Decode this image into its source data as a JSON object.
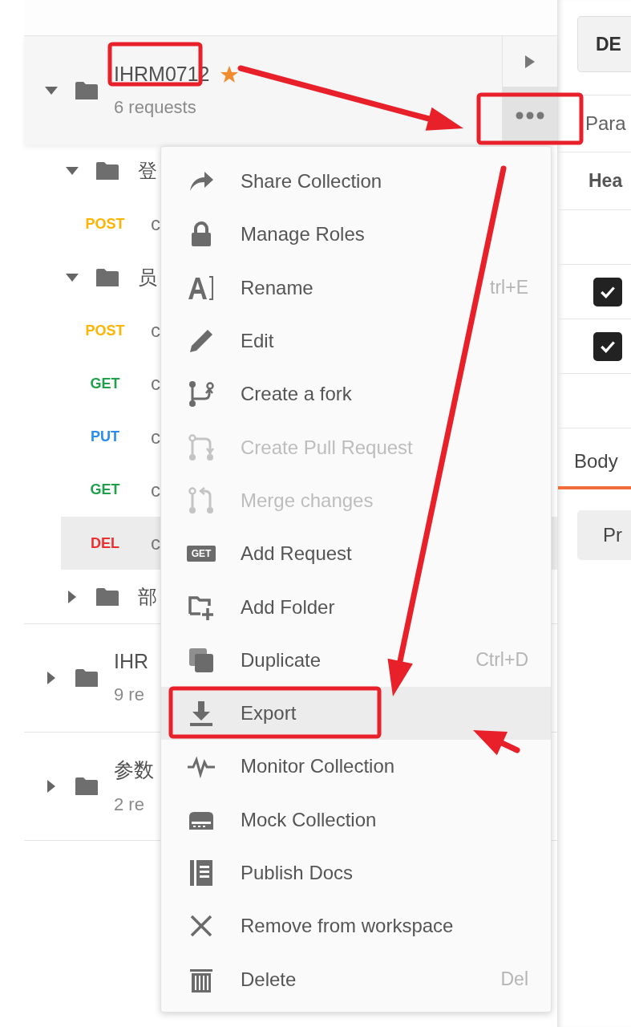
{
  "sidebar": {
    "collections": [
      {
        "name": "IHRM0712",
        "starred": true,
        "count": "6 requests",
        "expanded": true,
        "hovered": true,
        "children": [
          {
            "kind": "folder",
            "name": "登",
            "expanded": true,
            "children": [
              {
                "kind": "request",
                "method": "POST",
                "color": "#ffb400",
                "name": "c",
                "selected": false
              }
            ]
          },
          {
            "kind": "folder",
            "name": "员",
            "expanded": true,
            "children": [
              {
                "kind": "request",
                "method": "POST",
                "color": "#ffb400",
                "name": "c",
                "selected": false
              },
              {
                "kind": "request",
                "method": "GET",
                "color": "#20a04a",
                "name": "c",
                "selected": false
              },
              {
                "kind": "request",
                "method": "PUT",
                "color": "#2a8cef",
                "name": "c",
                "selected": false
              },
              {
                "kind": "request",
                "method": "GET",
                "color": "#20a04a",
                "name": "c",
                "selected": false
              },
              {
                "kind": "request",
                "method": "DEL",
                "color": "#ee2e2e",
                "name": "c",
                "selected": true
              }
            ]
          },
          {
            "kind": "folder",
            "name": "部",
            "expanded": false
          }
        ]
      },
      {
        "name": "IHR",
        "count": "9 re",
        "expanded": false,
        "hovered": false
      },
      {
        "name": "参数",
        "count": "2 re",
        "expanded": false,
        "hovered": false
      }
    ]
  },
  "context_menu": {
    "items": [
      {
        "kind": "share",
        "label": "Share Collection",
        "disabled": false,
        "selected": false
      },
      {
        "kind": "lock",
        "label": "Manage Roles",
        "disabled": false,
        "selected": false
      },
      {
        "kind": "rename",
        "label": "Rename",
        "shortcut": "trl+E",
        "disabled": false,
        "selected": false
      },
      {
        "kind": "pencil",
        "label": "Edit",
        "disabled": false,
        "selected": false
      },
      {
        "kind": "fork",
        "label": "Create a fork",
        "disabled": false,
        "selected": false
      },
      {
        "kind": "pull",
        "label": "Create Pull Request",
        "disabled": true,
        "selected": false
      },
      {
        "kind": "merge",
        "label": "Merge changes",
        "disabled": true,
        "selected": false
      },
      {
        "kind": "badge",
        "icon_text": "GET",
        "label": "Add Request",
        "disabled": false,
        "selected": false
      },
      {
        "kind": "folder-plus",
        "label": "Add Folder",
        "disabled": false,
        "selected": false
      },
      {
        "kind": "copy",
        "label": "Duplicate",
        "shortcut": "Ctrl+D",
        "disabled": false,
        "selected": false
      },
      {
        "kind": "download",
        "label": "Export",
        "disabled": false,
        "selected": true
      },
      {
        "kind": "pulse",
        "label": "Monitor Collection",
        "disabled": false,
        "selected": false
      },
      {
        "kind": "server",
        "label": "Mock Collection",
        "disabled": false,
        "selected": false
      },
      {
        "kind": "doc",
        "label": "Publish Docs",
        "disabled": false,
        "selected": false
      },
      {
        "kind": "close",
        "label": "Remove from workspace",
        "disabled": false,
        "selected": false
      },
      {
        "kind": "trash",
        "label": "Delete",
        "shortcut": "Del",
        "disabled": false,
        "selected": false
      }
    ]
  },
  "request_panel": {
    "method_button": "DE",
    "params_tab": "Para",
    "headers_label": "Hea",
    "header_rows": [
      {
        "checked": true
      },
      {
        "checked": true
      }
    ],
    "body_tab": {
      "label": "Body",
      "selected": true
    },
    "pretty_button": "Pr"
  }
}
